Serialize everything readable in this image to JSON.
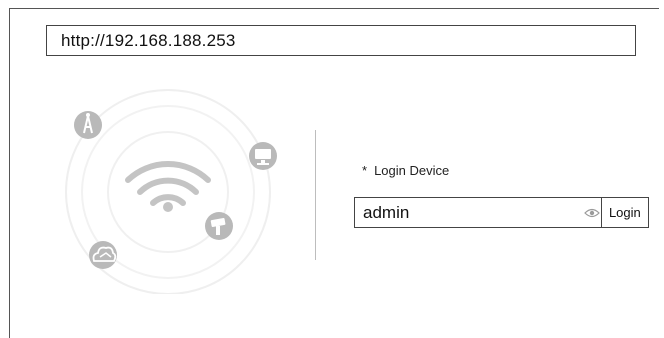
{
  "url_bar": {
    "value": "http://192.168.188.253"
  },
  "login": {
    "marker": "*",
    "label": "Login Device",
    "username": "admin",
    "button_label": "Login"
  },
  "icons": {
    "illustration": [
      "wifi-icon",
      "antenna-icon",
      "monitor-icon",
      "camera-icon",
      "cloud-icon"
    ],
    "password_toggle": "eye-icon"
  },
  "colors": {
    "ring": "#eeeeee",
    "icon_gray": "#b8b8b8",
    "border": "#444444"
  }
}
